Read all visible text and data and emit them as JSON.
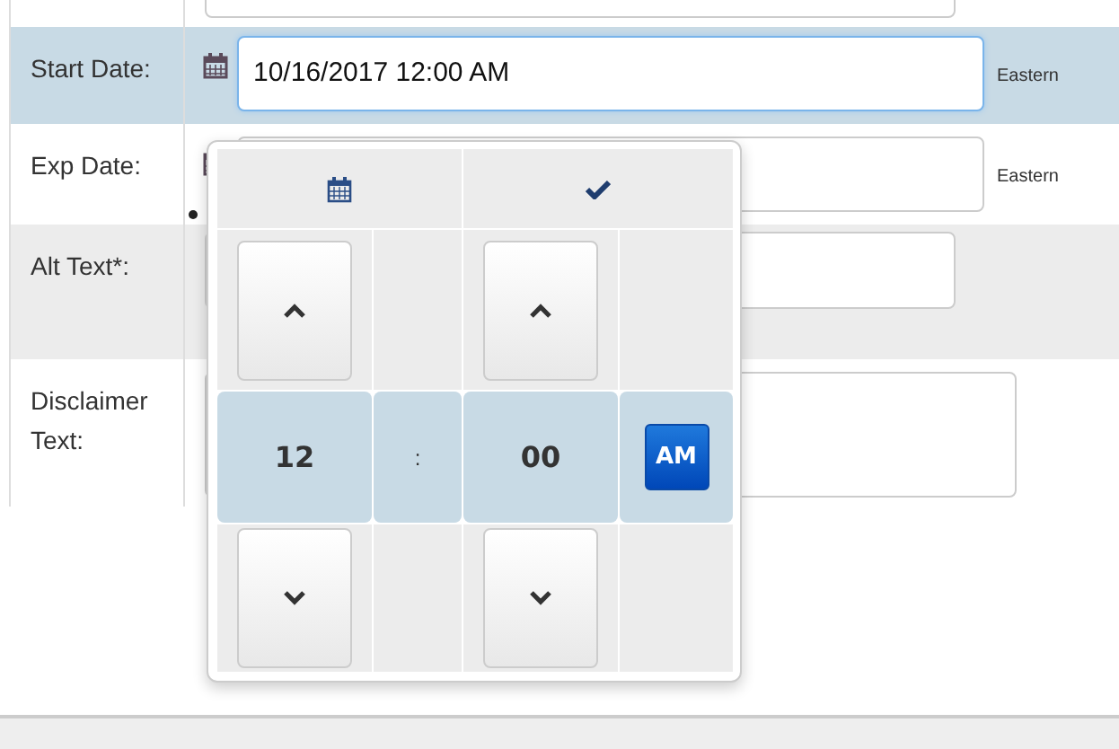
{
  "rows": [
    {
      "kind": "input"
    },
    {
      "kind": "datetime",
      "label": "Start Date:",
      "value": "10/16/2017 12:00 AM",
      "timezone": "Eastern",
      "selected": true
    },
    {
      "kind": "datetime",
      "label": "Exp Date:",
      "timezone": "Eastern",
      "selected": false
    },
    {
      "kind": "input",
      "label": "Alt Text*:"
    },
    {
      "kind": "textarea",
      "label": "Disclaimer Text:"
    }
  ],
  "time_picker": {
    "hours": "12",
    "separator": ":",
    "minutes": "00",
    "period": "AM"
  }
}
